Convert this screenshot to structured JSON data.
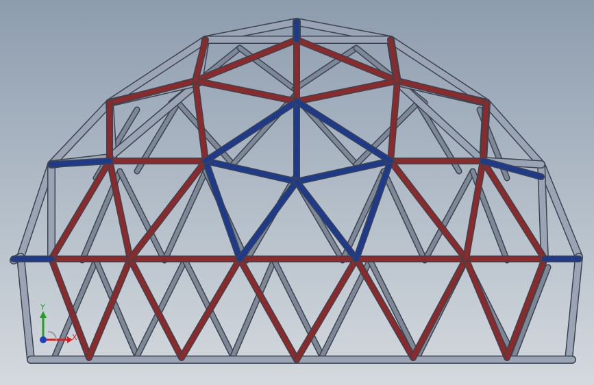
{
  "viewport": {
    "colors": {
      "strut_gray": "#9aa4b4",
      "strut_gray_dark": "#3c4350",
      "strut_red": "#8a2a2a",
      "strut_blue": "#1e3a8a",
      "axis_x": "#d92020",
      "axis_y": "#22a022",
      "axis_z": "#2040c0"
    }
  },
  "triad": {
    "x_label": "X",
    "y_label": "Y"
  }
}
